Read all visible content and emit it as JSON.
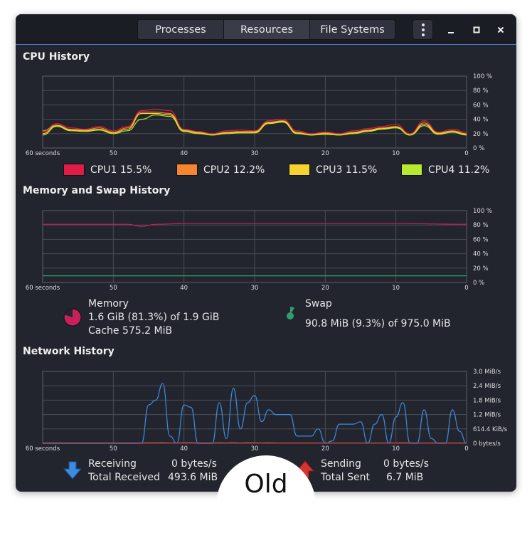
{
  "tabs": [
    "Processes",
    "Resources",
    "File Systems"
  ],
  "active_tab": "Resources",
  "sections": {
    "cpu": {
      "title": "CPU History",
      "legend": [
        {
          "label": "CPU1",
          "value": "15.5%",
          "color": "#e01b46"
        },
        {
          "label": "CPU2",
          "value": "12.2%",
          "color": "#f6852f"
        },
        {
          "label": "CPU3",
          "value": "11.5%",
          "color": "#f6d32d"
        },
        {
          "label": "CPU4",
          "value": "11.2%",
          "color": "#b8e82f"
        }
      ]
    },
    "memory": {
      "title": "Memory and Swap History",
      "memory_label": "Memory",
      "memory_usage": "1.6 GiB (81.3%) of 1.9 GiB",
      "memory_cache": "Cache 575.2 MiB",
      "swap_label": "Swap",
      "swap_usage": "90.8 MiB (9.3%) of 975.0 MiB",
      "memory_color": "#c8205a",
      "swap_color": "#2fa06b"
    },
    "network": {
      "title": "Network History",
      "receiving_label": "Receiving",
      "receiving_value": "0 bytes/s",
      "total_received_label": "Total Received",
      "total_received_value": "493.6 MiB",
      "sending_label": "Sending",
      "sending_value": "0 bytes/s",
      "total_sent_label": "Total Sent",
      "total_sent_value": "6.7 MiB",
      "receiving_color": "#3b8be0",
      "sending_color": "#d8312f"
    }
  },
  "x_axis_ticks": [
    "60 seconds",
    "50",
    "40",
    "30",
    "20",
    "10",
    "0"
  ],
  "percent_ticks": [
    "100 %",
    "80 %",
    "60 %",
    "40 %",
    "20 %",
    "0 %"
  ],
  "network_ticks": [
    "3.0 MiB/s",
    "2.4 MiB/s",
    "1.8 MiB/s",
    "1.2 MiB/s",
    "614.4 KiB/s",
    "0 bytes/s"
  ],
  "badge": "Old",
  "chart_data": [
    {
      "type": "line",
      "title": "CPU History",
      "xlabel": "",
      "ylabel": "",
      "xlim": [
        60,
        0
      ],
      "ylim": [
        0,
        100
      ],
      "x": [
        60,
        58,
        56,
        54,
        52,
        50,
        48,
        46,
        44,
        42,
        40,
        38,
        36,
        34,
        32,
        30,
        28,
        26,
        24,
        22,
        20,
        18,
        16,
        14,
        12,
        10,
        8,
        6,
        4,
        2,
        0
      ],
      "series": [
        {
          "name": "CPU1",
          "values": [
            22,
            34,
            28,
            26,
            30,
            24,
            30,
            52,
            54,
            52,
            26,
            23,
            20,
            24,
            25,
            24,
            38,
            40,
            24,
            20,
            22,
            20,
            24,
            27,
            30,
            33,
            20,
            38,
            22,
            26,
            22
          ]
        },
        {
          "name": "CPU2",
          "values": [
            24,
            32,
            26,
            25,
            28,
            22,
            28,
            50,
            50,
            48,
            25,
            22,
            19,
            22,
            23,
            23,
            36,
            38,
            22,
            19,
            21,
            19,
            22,
            25,
            28,
            30,
            19,
            35,
            21,
            24,
            20
          ]
        },
        {
          "name": "CPU3",
          "values": [
            20,
            31,
            25,
            24,
            26,
            21,
            26,
            48,
            48,
            46,
            24,
            21,
            18,
            21,
            22,
            22,
            35,
            37,
            21,
            18,
            20,
            18,
            21,
            24,
            27,
            29,
            18,
            33,
            20,
            23,
            19
          ]
        },
        {
          "name": "CPU4",
          "values": [
            18,
            30,
            24,
            23,
            25,
            20,
            24,
            40,
            46,
            44,
            23,
            20,
            18,
            20,
            21,
            21,
            34,
            36,
            20,
            18,
            19,
            18,
            20,
            23,
            26,
            28,
            18,
            31,
            19,
            22,
            18
          ]
        }
      ]
    },
    {
      "type": "line",
      "title": "Memory and Swap History",
      "xlabel": "",
      "ylabel": "",
      "xlim": [
        60,
        0
      ],
      "ylim": [
        0,
        100
      ],
      "x": [
        60,
        54,
        48,
        46,
        44,
        40,
        30,
        20,
        10,
        0
      ],
      "series": [
        {
          "name": "Memory",
          "values": [
            81,
            81,
            81,
            78,
            81,
            82,
            82,
            82,
            82,
            81
          ]
        },
        {
          "name": "Swap",
          "values": [
            9.3,
            9.3,
            9.3,
            9.3,
            9.3,
            9.3,
            9.3,
            9.3,
            9.3,
            9.3
          ]
        }
      ]
    },
    {
      "type": "line",
      "title": "Network History",
      "xlabel": "",
      "ylabel": "",
      "xlim": [
        60,
        0
      ],
      "ylim": [
        0,
        3.0
      ],
      "x": [
        60,
        50,
        46,
        45,
        44,
        43,
        42,
        41,
        40,
        39,
        38,
        37,
        36,
        35,
        34,
        33,
        32,
        31,
        30,
        29,
        28,
        27,
        26,
        25,
        24,
        23,
        22,
        21,
        20,
        19,
        18,
        17,
        16,
        15,
        14,
        13,
        12,
        11,
        10,
        9,
        8,
        7,
        6,
        5,
        4,
        3,
        2,
        1,
        0
      ],
      "series": [
        {
          "name": "Receiving",
          "values": [
            0,
            0,
            0,
            1.6,
            1.8,
            2.5,
            0.3,
            0,
            1.6,
            1.5,
            0,
            0,
            0,
            1.7,
            0.2,
            2.3,
            0.6,
            1.7,
            2.0,
            0.9,
            1.4,
            1.2,
            1.2,
            1.2,
            0.3,
            0.3,
            0.3,
            0.6,
            0,
            0.1,
            0.8,
            0.8,
            0.8,
            0.9,
            0,
            0.8,
            1.2,
            0,
            1.1,
            1.7,
            0,
            0,
            1.4,
            0.2,
            0,
            0,
            1.4,
            0.5,
            0
          ]
        },
        {
          "name": "Sending",
          "values": [
            0.02,
            0.02,
            0.02,
            0.03,
            0.03,
            0.04,
            0.02,
            0.02,
            0.03,
            0.03,
            0.02,
            0.02,
            0.02,
            0.03,
            0.02,
            0.04,
            0.02,
            0.03,
            0.03,
            0.02,
            0.03,
            0.02,
            0.02,
            0.02,
            0.02,
            0.02,
            0.02,
            0.02,
            0.02,
            0.02,
            0.02,
            0.02,
            0.02,
            0.02,
            0.02,
            0.02,
            0.02,
            0.02,
            0.02,
            0.03,
            0.02,
            0.02,
            0.02,
            0.02,
            0.02,
            0.02,
            0.02,
            0.02,
            0.02
          ]
        }
      ]
    }
  ]
}
